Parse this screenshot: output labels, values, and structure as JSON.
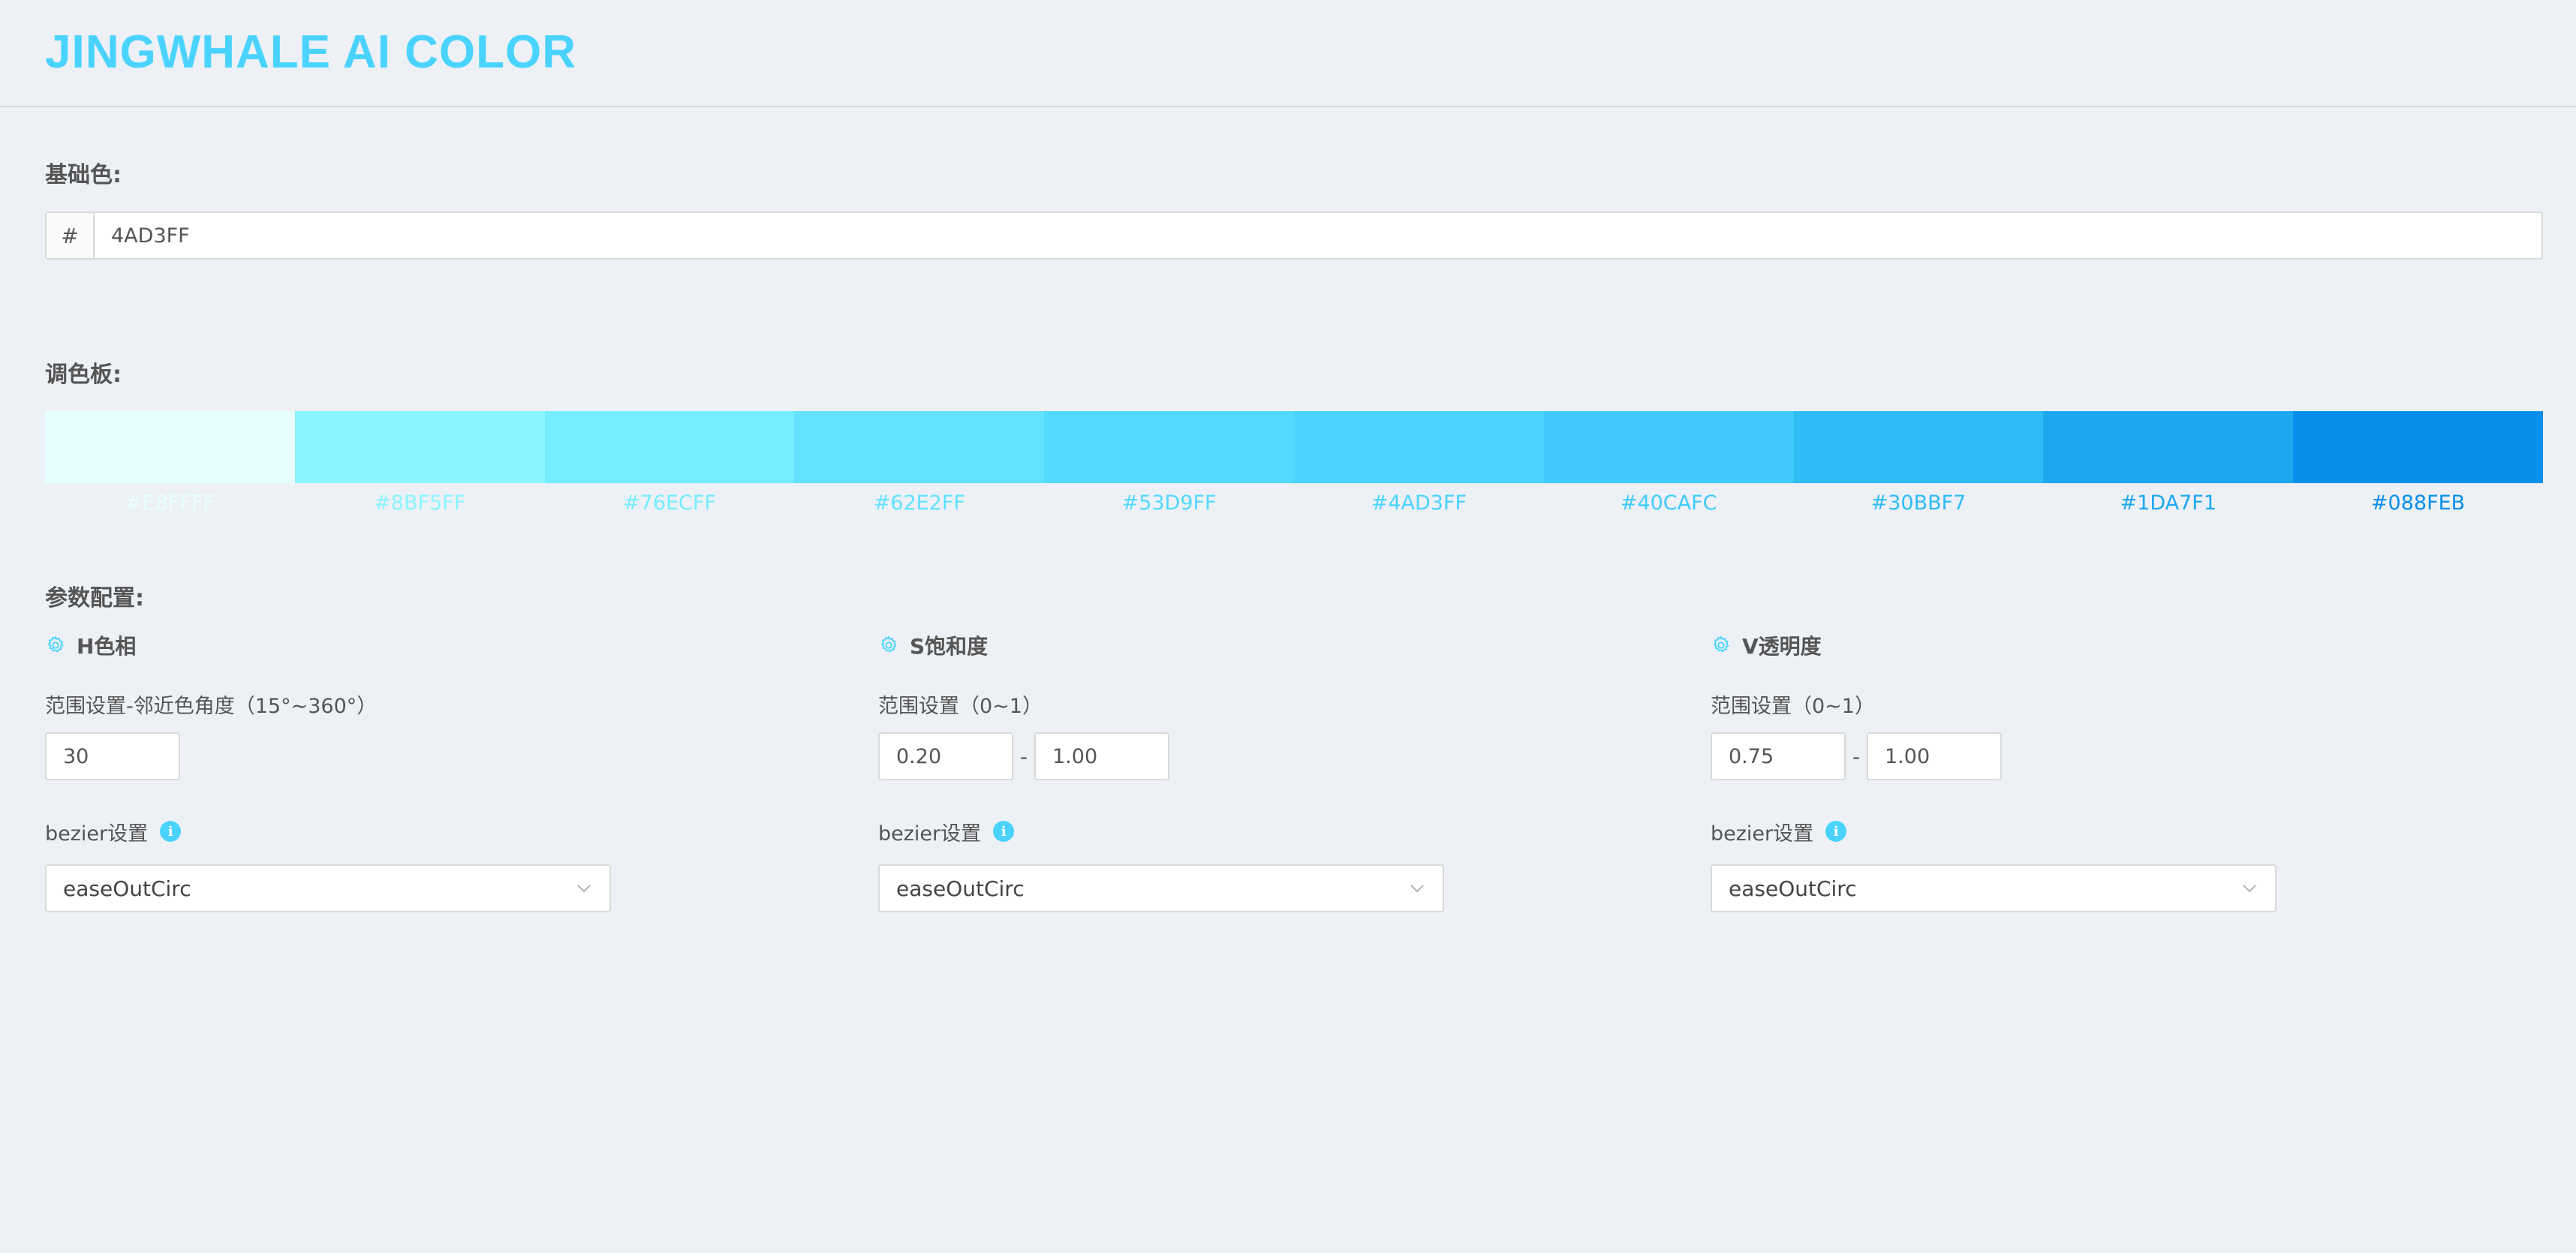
{
  "app": {
    "title": "JINGWHALE AI COLOR"
  },
  "base": {
    "label": "基础色:",
    "prefix": "#",
    "value": "4AD3FF"
  },
  "palette": {
    "label": "调色板:",
    "swatches": [
      {
        "hex": "#E8FFFF"
      },
      {
        "hex": "#8BF5FF"
      },
      {
        "hex": "#76ECFF"
      },
      {
        "hex": "#62E2FF"
      },
      {
        "hex": "#53D9FF"
      },
      {
        "hex": "#4AD3FF"
      },
      {
        "hex": "#40CAFC"
      },
      {
        "hex": "#30BBF7"
      },
      {
        "hex": "#1DA7F1"
      },
      {
        "hex": "#088FEB"
      }
    ]
  },
  "params": {
    "label": "参数配置:",
    "columns": [
      {
        "title": "H色相",
        "icon": "gear-icon",
        "range_label": "范围设置-邻近色角度（15°~360°）",
        "values": [
          "30"
        ],
        "bezier_label": "bezier设置",
        "bezier_value": "easeOutCirc"
      },
      {
        "title": "S饱和度",
        "icon": "gear-icon",
        "range_label": "范围设置（0~1）",
        "values": [
          "0.20",
          "1.00"
        ],
        "separator": "-",
        "bezier_label": "bezier设置",
        "bezier_value": "easeOutCirc"
      },
      {
        "title": "V透明度",
        "icon": "gear-icon",
        "range_label": "范围设置（0~1）",
        "values": [
          "0.75",
          "1.00"
        ],
        "separator": "-",
        "bezier_label": "bezier设置",
        "bezier_value": "easeOutCirc"
      }
    ]
  },
  "colors": {
    "accent": "#4AD3FF",
    "background": "#EDF1F5",
    "border": "#D9D9D9"
  },
  "info_glyph": "i"
}
